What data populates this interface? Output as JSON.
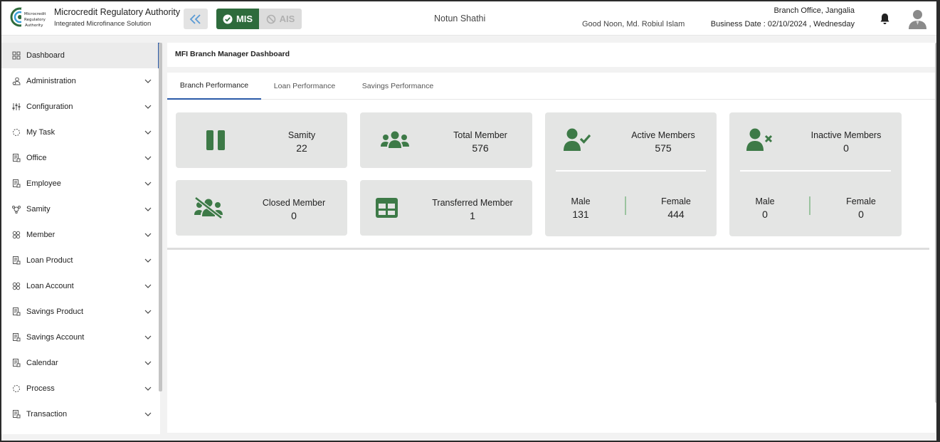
{
  "header": {
    "brand_title": "Microcredit Regulatory Authority",
    "brand_subtitle": "Integrated Microfinance Solution",
    "logo_text": "Microcredit Regulatory Authority",
    "mode_mis": "MIS",
    "mode_ais": "AIS",
    "org_name": "Notun Shathi",
    "greeting": "Good Noon, Md. Robiul Islam",
    "branch": "Branch Office, Jangalia",
    "business_date": "Business Date : 02/10/2024 , Wednesday",
    "accent_color": "#2e6b3c"
  },
  "sidebar": {
    "items": [
      {
        "label": "Dashboard",
        "icon": "grid-icon"
      },
      {
        "label": "Administration",
        "icon": "admin-icon"
      },
      {
        "label": "Configuration",
        "icon": "sliders-icon"
      },
      {
        "label": "My Task",
        "icon": "spinner-icon"
      },
      {
        "label": "Office",
        "icon": "document-icon"
      },
      {
        "label": "Employee",
        "icon": "document-icon"
      },
      {
        "label": "Samity",
        "icon": "group-icon"
      },
      {
        "label": "Member",
        "icon": "members-icon"
      },
      {
        "label": "Loan Product",
        "icon": "document-icon"
      },
      {
        "label": "Loan Account",
        "icon": "members-icon"
      },
      {
        "label": "Savings Product",
        "icon": "document-icon"
      },
      {
        "label": "Savings Account",
        "icon": "document-icon"
      },
      {
        "label": "Calendar",
        "icon": "document-icon"
      },
      {
        "label": "Process",
        "icon": "spinner-icon"
      },
      {
        "label": "Transaction",
        "icon": "document-icon"
      }
    ]
  },
  "main": {
    "page_title": "MFI Branch Manager Dashboard",
    "tabs": [
      "Branch Performance",
      "Loan Performance",
      "Savings Performance"
    ],
    "cards": {
      "samity": {
        "label": "Samity",
        "value": "22"
      },
      "total_member": {
        "label": "Total Member",
        "value": "576"
      },
      "closed_member": {
        "label": "Closed Member",
        "value": "0"
      },
      "transferred_member": {
        "label": "Transferred Member",
        "value": "1"
      },
      "active_members": {
        "label": "Active Members",
        "value": "575",
        "male_label": "Male",
        "male_value": "131",
        "female_label": "Female",
        "female_value": "444"
      },
      "inactive_members": {
        "label": "Inactive Members",
        "value": "0",
        "male_label": "Male",
        "male_value": "0",
        "female_label": "Female",
        "female_value": "0"
      }
    }
  }
}
